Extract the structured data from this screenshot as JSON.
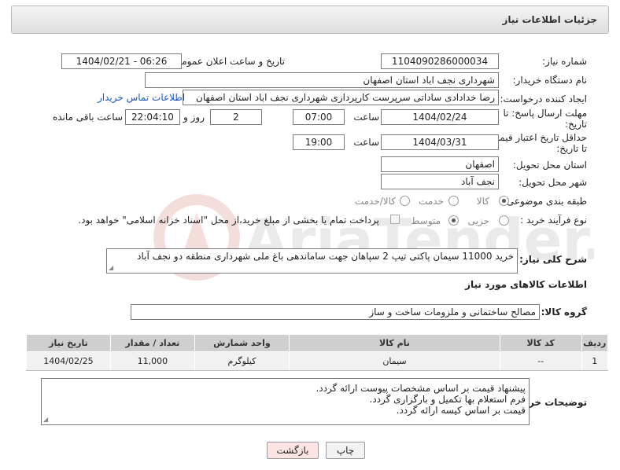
{
  "header": {
    "title": "جزئیات اطلاعات نیاز"
  },
  "fields": {
    "need_number": {
      "label": "شماره نیاز:",
      "value": "1104090286000034"
    },
    "announce": {
      "label": "تاریخ و ساعت اعلان عمومی:",
      "value": "1404/02/21 - 06:26"
    },
    "buyer_org": {
      "label": "نام دستگاه خریدار:",
      "value": "شهرداری نجف اباد استان اصفهان"
    },
    "creator": {
      "label": "ایجاد کننده درخواست:",
      "value": "رضا خدادادی ساداتی سرپرست  کارپردازی شهرداری نجف اباد استان اصفهان",
      "contact_link": "اطلاعات تماس خریدار"
    },
    "deadline": {
      "label_line1": "مهلت ارسال پاسخ: تا",
      "label_line2": "تاریخ:",
      "date": "1404/02/24",
      "time_label": "ساعت",
      "time": "07:00",
      "days": "2",
      "days_label": "روز و",
      "remaining": "22:04:10",
      "remaining_label": "ساعت باقی مانده"
    },
    "validity": {
      "label_line1": "حداقل تاریخ اعتبار قیمت:",
      "label_line2": "تا تاریخ:",
      "date": "1404/03/31",
      "time_label": "ساعت",
      "time": "19:00"
    },
    "province": {
      "label": "استان محل تحویل:",
      "value": "اصفهان"
    },
    "city": {
      "label": "شهر محل تحویل:",
      "value": "نجف آباد"
    },
    "category": {
      "label": "طبقه بندی موضوعی:",
      "options": [
        "کالا",
        "خدمت",
        "کالا/خدمت"
      ],
      "selected": "کالا"
    },
    "process": {
      "label": "نوع فرآیند خرید :",
      "options": [
        "جزیی",
        "متوسط"
      ],
      "selected": "متوسط",
      "payment_note": "پرداخت تمام یا بخشی از مبلغ خرید،از محل \"اسناد خزانه اسلامی\" خواهد بود."
    }
  },
  "description": {
    "label": "شرح کلی نیاز:",
    "value": "خرید 11000 سیمان پاکتی تیپ 2 سپاهان جهت ساماندهی باغ ملی شهرداری منطقه دو نجف آباد"
  },
  "goods_info": {
    "section_title": "اطلاعات کالاهای مورد نیاز",
    "group_label": "گروه کالا:",
    "group_value": "مصالح ساختمانی و ملزومات ساخت و ساز"
  },
  "table": {
    "headers": [
      "ردیف",
      "کد کالا",
      "نام کالا",
      "واحد شمارش",
      "تعداد / مقدار",
      "تاریخ نیاز"
    ],
    "rows": [
      [
        "1",
        "--",
        "سیمان",
        "کیلوگرم",
        "11,000",
        "1404/02/25"
      ]
    ]
  },
  "buyer_notes": {
    "label": "توضیحات خریدار:",
    "lines": [
      "پیشنهاد قیمت بر اساس مشخصات پیوست ارائه گردد.",
      "فرم استعلام بها تکمیل و بارگزاری گردد.",
      "قیمت بر اساس کیسه ارائه گردد."
    ]
  },
  "buttons": {
    "print": "چاپ",
    "back": "بازگشت"
  },
  "colors": {
    "link": "#1a55c8",
    "header_bg": "#e6e6e6",
    "table_header": "#cfcfcf",
    "back_btn_bg": "#fde4e4"
  }
}
